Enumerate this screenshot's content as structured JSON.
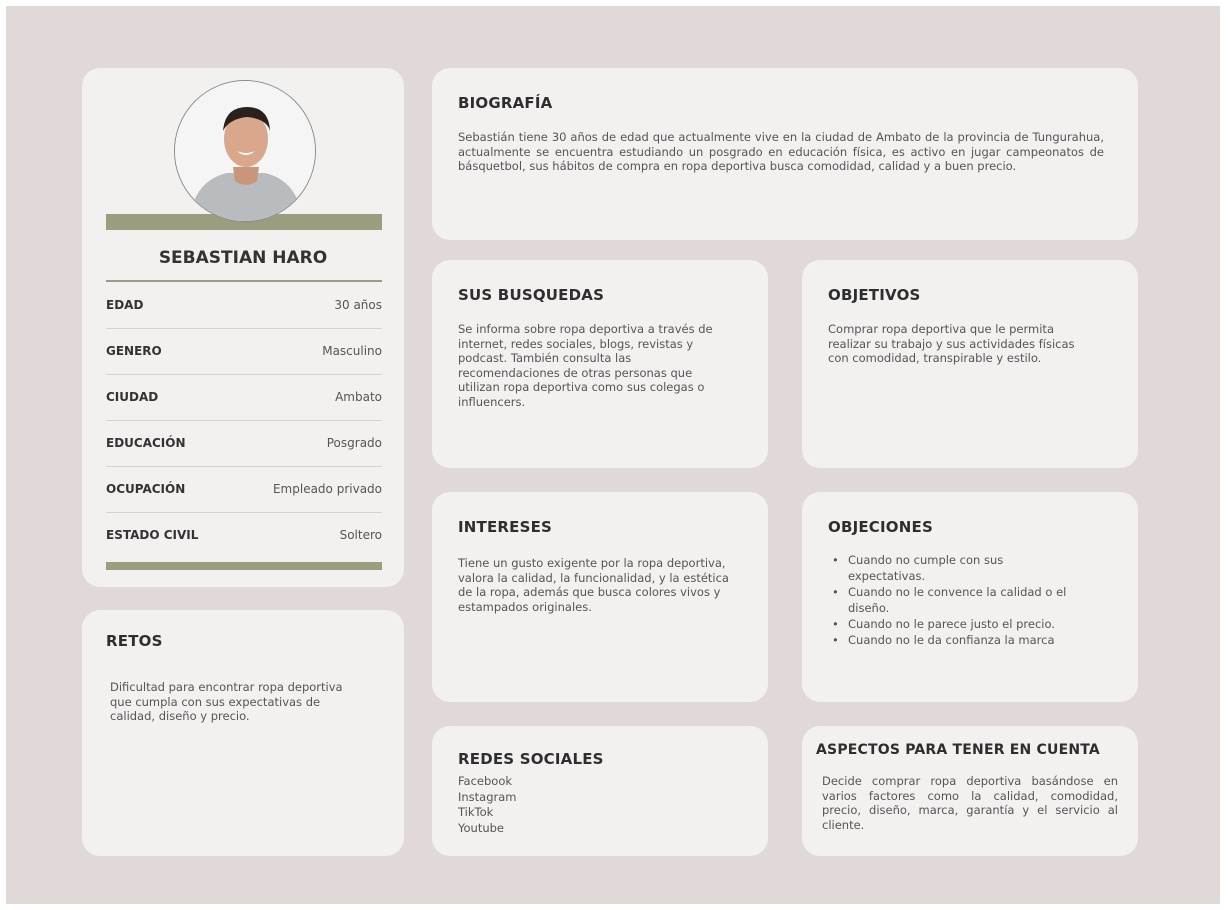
{
  "profile": {
    "name": "SEBASTIAN HARO",
    "rows": [
      {
        "key": "EDAD",
        "value": "30 años"
      },
      {
        "key": "GENERO",
        "value": "Masculino"
      },
      {
        "key": "CIUDAD",
        "value": "Ambato"
      },
      {
        "key": "EDUCACIÓN",
        "value": "Posgrado"
      },
      {
        "key": "OCUPACIÓN",
        "value": "Empleado privado"
      },
      {
        "key": "ESTADO CIVIL",
        "value": "Soltero"
      }
    ]
  },
  "biografia": {
    "title": "BIOGRAFÍA",
    "text": "Sebastián tiene 30 años de edad que actualmente vive en la ciudad de Ambato de la provincia de Tungurahua, actualmente se encuentra estudiando un posgrado en educación física, es activo en jugar campeonatos de básquetbol, sus hábitos de compra en ropa deportiva busca comodidad, calidad y a buen precio."
  },
  "busquedas": {
    "title": "SUS BUSQUEDAS",
    "text": "Se informa sobre ropa deportiva a través de internet, redes sociales, blogs, revistas y podcast. También consulta las recomendaciones de otras personas que utilizan ropa deportiva como sus colegas o influencers."
  },
  "objetivos": {
    "title": "OBJETIVOS",
    "text": "Comprar ropa deportiva que le permita realizar su trabajo y sus actividades físicas con comodidad, transpirable y estilo."
  },
  "intereses": {
    "title": "INTERESES",
    "text": "Tiene un gusto exigente por la ropa deportiva, valora la calidad, la funcionalidad, y la estética de la ropa, además que busca colores vivos y estampados originales."
  },
  "objeciones": {
    "title": "OBJECIONES",
    "items": [
      "Cuando no cumple con sus expectativas.",
      "Cuando no le convence la calidad o el diseño.",
      "Cuando no le parece justo el precio.",
      "Cuando no le da confianza la marca"
    ]
  },
  "retos": {
    "title": "RETOS",
    "text": "Dificultad para encontrar ropa deportiva que cumpla con sus expectativas de calidad, diseño y precio."
  },
  "redes": {
    "title": "REDES SOCIALES",
    "items": [
      "Facebook",
      "Instagram",
      "TikTok",
      "Youtube"
    ]
  },
  "aspectos": {
    "title": "ASPECTOS PARA TENER EN CUENTA",
    "text": "Decide comprar ropa deportiva basándose en varios factores como la calidad, comodidad, precio, diseño, marca, garantía y el servicio al cliente."
  },
  "colors": {
    "background": "#e0d9d7",
    "card": "#f3f0f0",
    "accent": "#9a9e7e"
  }
}
